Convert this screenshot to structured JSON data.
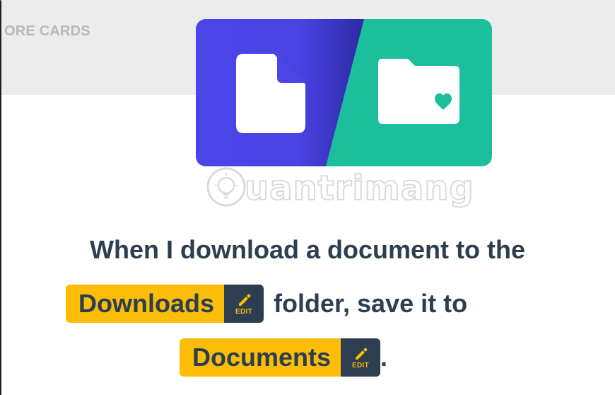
{
  "header": {
    "more_cards_label": "ORE CARDS"
  },
  "hero": {
    "left_color": "#4b45e8",
    "right_color": "#1bbf9c",
    "left_icon": "document-icon",
    "right_icon": "folder-heart-icon"
  },
  "watermark": {
    "text": "uantrimang",
    "icon": "lightbulb-icon"
  },
  "sentence": {
    "line1": "When I download a document to the",
    "source_folder": "Downloads",
    "line2_tail": "folder, save it to",
    "target_folder": "Documents",
    "line3_tail": ".",
    "edit_label": "EDIT"
  },
  "colors": {
    "token_bg": "#fbbd08",
    "token_edit_bg": "#2c3e50",
    "text": "#2c3e50"
  }
}
